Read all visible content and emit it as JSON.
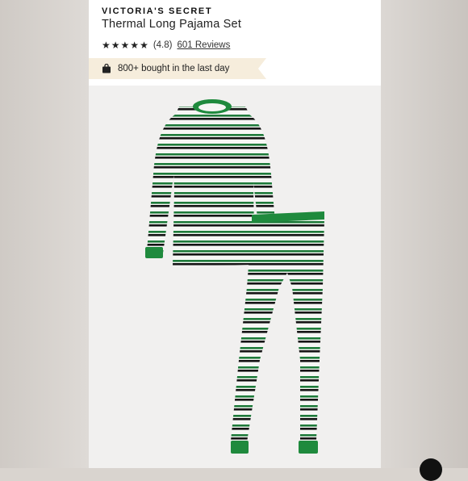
{
  "product": {
    "brand": "VICTORIA'S SECRET",
    "name": "Thermal Long Pajama Set",
    "rating_value": "(4.8)",
    "stars": 5,
    "reviews_label": "601 Reviews"
  },
  "badge": {
    "icon": "shopping-bag-icon",
    "text": "800+ bought in the last day"
  },
  "image": {
    "subject": "striped-thermal-pajama-set",
    "colors": {
      "stripe_green": "#1e7a3a",
      "stripe_black": "#111111",
      "stripe_white": "#f5f5f5",
      "trim": "#1f8a3d"
    }
  },
  "colors": {
    "badge_bg": "#f6eddc",
    "image_bg": "#f1f0ef"
  }
}
